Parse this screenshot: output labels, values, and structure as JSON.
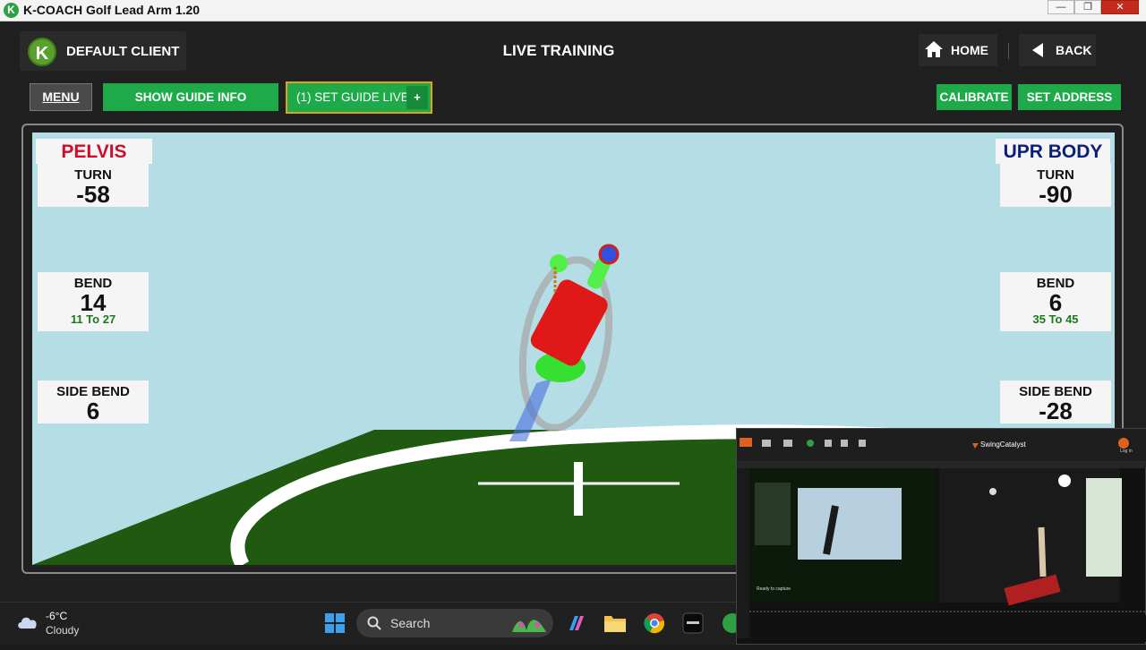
{
  "window": {
    "title": "K-COACH Golf Lead Arm 1.20",
    "icon_letter": "K",
    "controls": [
      "—",
      "❐",
      "✕"
    ]
  },
  "header": {
    "client_logo_letter": "K",
    "client_name": "DEFAULT CLIENT",
    "page_title": "LIVE TRAINING",
    "home_label": "HOME",
    "back_label": "BACK"
  },
  "toolbar": {
    "menu_label": "MENU",
    "show_guide_info_label": "SHOW GUIDE INFO",
    "set_guide_live_label": "(1) SET GUIDE LIVE",
    "set_guide_plus": "+",
    "calibrate_label": "CALIBRATE",
    "set_address_label": "SET ADDRESS"
  },
  "pelvis": {
    "header": "PELVIS",
    "turn": {
      "label": "TURN",
      "value": "-58"
    },
    "bend": {
      "label": "BEND",
      "value": "14",
      "range": "11 To 27"
    },
    "side_bend": {
      "label": "SIDE BEND",
      "value": "6"
    }
  },
  "upper_body": {
    "header": "UPR BODY",
    "turn": {
      "label": "TURN",
      "value": "-90"
    },
    "bend": {
      "label": "BEND",
      "value": "6",
      "range": "35 To 45"
    },
    "side_bend": {
      "label": "SIDE BEND",
      "value": "-28"
    }
  },
  "inset": {
    "app_name": "SwingCatalyst",
    "status_text": "Ready to capture",
    "login_label": "Log in"
  },
  "taskbar": {
    "weather_temp": "-6°C",
    "weather_cond": "Cloudy",
    "search_label": "Search"
  },
  "colors": {
    "accent_green": "#1faa4a",
    "pelvis_red": "#c8102e",
    "upper_body_navy": "#0b1f7a",
    "range_green": "#1b7a1b",
    "sky": "#b4dde6",
    "ground": "#1f5a10"
  }
}
